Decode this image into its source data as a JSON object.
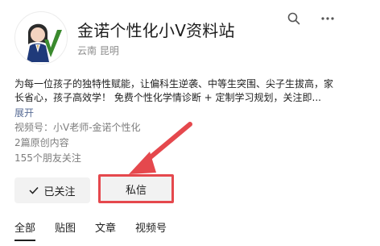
{
  "profile": {
    "name": "金诺个性化小V资料站",
    "location": "云南 昆明",
    "description": "为每一位孩子的独特性赋能，让偏科生逆袭、中等生突围、尖子生拔高，家长省心，孩子高效学！ 免费个性化学情诊断 + 定制学习规划，关注即...",
    "expand_label": "展开",
    "channel": "视频号：小V老师-金诺个性化",
    "posts": "2篇原创内容",
    "friends_following": "155个朋友关注"
  },
  "actions": {
    "followed_label": "已关注",
    "message_label": "私信"
  },
  "tabs": [
    {
      "label": "全部",
      "active": true
    },
    {
      "label": "贴图",
      "active": false
    },
    {
      "label": "文章",
      "active": false
    },
    {
      "label": "视频号",
      "active": false
    }
  ],
  "icons": {
    "search": "search-icon",
    "more": "more-icon",
    "check": "check-icon"
  },
  "colors": {
    "highlight": "#e5484d",
    "link": "#576b95",
    "button_bg": "#f2f2f2"
  }
}
